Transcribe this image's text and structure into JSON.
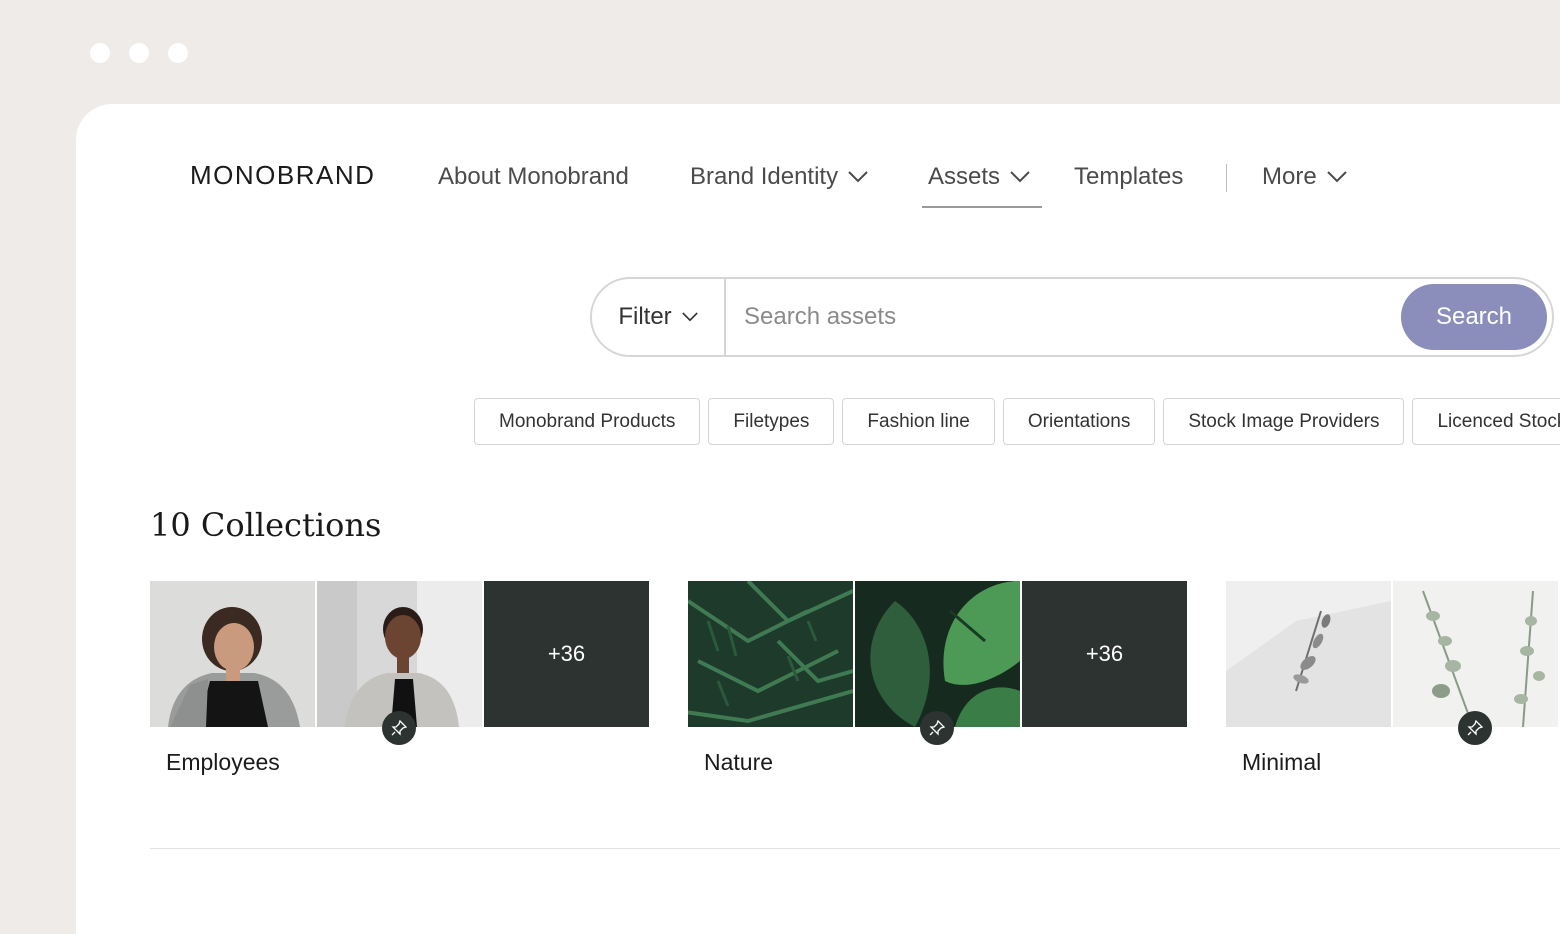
{
  "brand": {
    "logo_text": "MONOBRAND"
  },
  "nav": {
    "items": [
      {
        "label": "About Monobrand",
        "has_dropdown": false,
        "active": false
      },
      {
        "label": "Brand Identity",
        "has_dropdown": true,
        "active": false
      },
      {
        "label": "Assets",
        "has_dropdown": true,
        "active": true
      },
      {
        "label": "Templates",
        "has_dropdown": false,
        "active": false
      },
      {
        "label": "More",
        "has_dropdown": true,
        "active": false
      }
    ]
  },
  "search": {
    "filter_label": "Filter",
    "placeholder": "Search assets",
    "button_label": "Search"
  },
  "chips": [
    "Monobrand Products",
    "Filetypes",
    "Fashion line",
    "Orientations",
    "Stock Image Providers",
    "Licenced Stock"
  ],
  "collections": {
    "heading": "10 Collections",
    "items": [
      {
        "name": "Employees",
        "more_count": "+36"
      },
      {
        "name": "Nature",
        "more_count": "+36"
      },
      {
        "name": "Minimal",
        "more_count": ""
      }
    ]
  },
  "colors": {
    "accent": "#8b8ebb",
    "dark_tile": "#2c3331",
    "background": "#efebe9"
  }
}
